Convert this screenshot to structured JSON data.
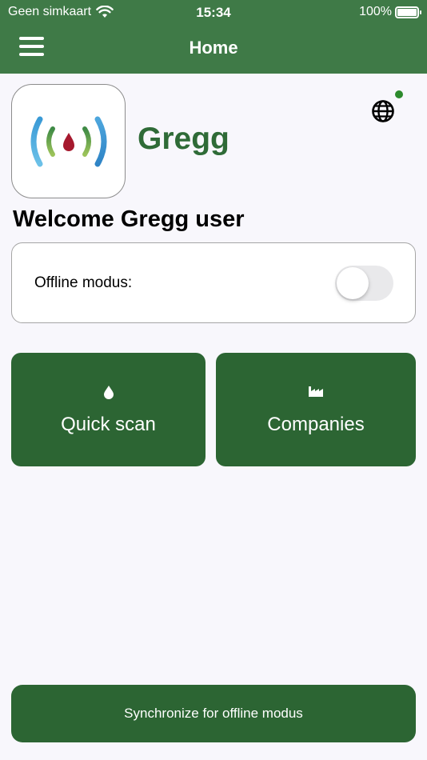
{
  "status_bar": {
    "carrier": "Geen simkaart",
    "time": "15:34",
    "battery": "100%"
  },
  "header": {
    "title": "Home"
  },
  "brand": {
    "name": "Gregg"
  },
  "welcome_text": "Welcome Gregg user",
  "offline": {
    "label": "Offline modus:",
    "enabled": false
  },
  "tiles": {
    "quick_scan": {
      "label": "Quick scan",
      "icon": "drop-icon"
    },
    "companies": {
      "label": "Companies",
      "icon": "factory-icon"
    }
  },
  "sync_button": {
    "label": "Synchronize for offline modus"
  },
  "colors": {
    "header": "#3f7a47",
    "primary": "#2c6533",
    "brand_text": "#2f6b37",
    "online_indicator": "#2c8a2c",
    "background": "#f8f7fc"
  }
}
